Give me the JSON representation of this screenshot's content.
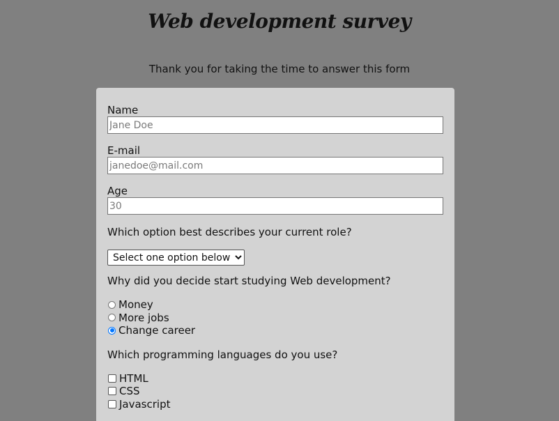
{
  "header": {
    "title": "Web development survey",
    "description": "Thank you for taking the time to answer this form"
  },
  "form": {
    "name": {
      "label": "Name",
      "placeholder": "Jane Doe"
    },
    "email": {
      "label": "E-mail",
      "placeholder": "janedoe@mail.com"
    },
    "age": {
      "label": "Age",
      "placeholder": "30"
    },
    "role": {
      "question": "Which option best describes your current role?",
      "selected": "Select one option below"
    },
    "reason": {
      "question": "Why did you decide start studying Web development?",
      "options": [
        {
          "label": "Money",
          "checked": false
        },
        {
          "label": "More jobs",
          "checked": false
        },
        {
          "label": "Change career",
          "checked": true
        }
      ]
    },
    "languages": {
      "question": "Which programming languages do you use?",
      "options": [
        {
          "label": "HTML",
          "checked": false
        },
        {
          "label": "CSS",
          "checked": false
        },
        {
          "label": "Javascript",
          "checked": false
        }
      ]
    }
  },
  "colors": {
    "page_background": "#808080",
    "form_background": "#d3d3d3",
    "accent": "#0075ff"
  }
}
